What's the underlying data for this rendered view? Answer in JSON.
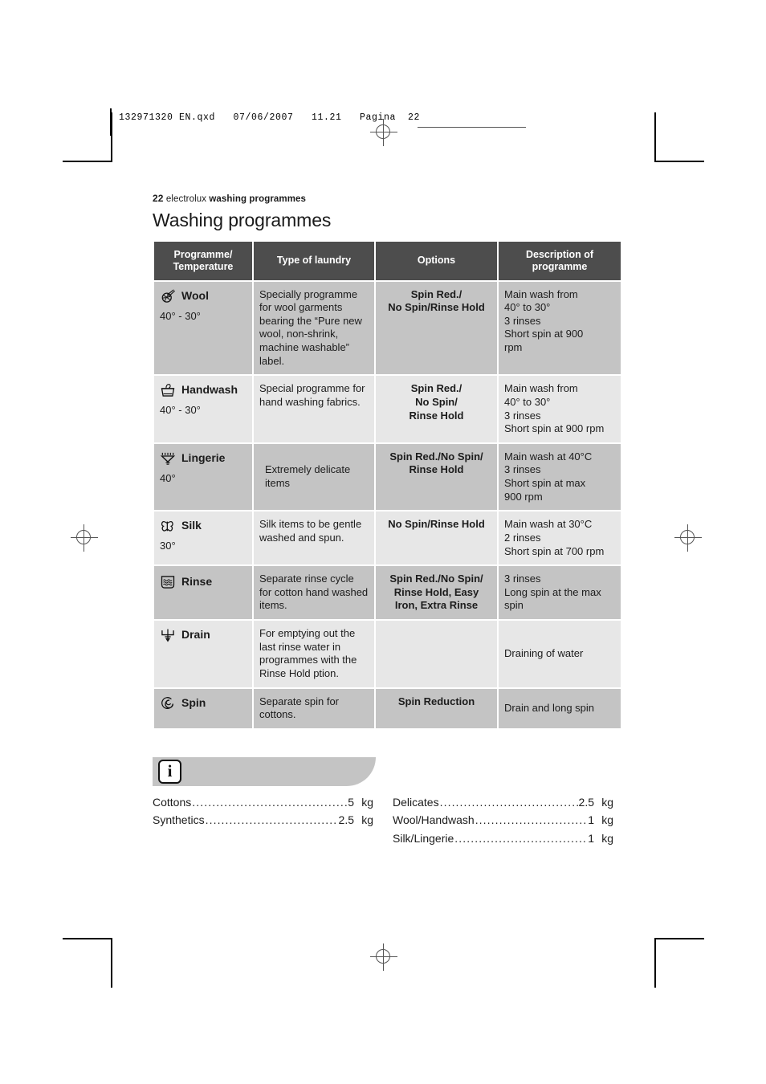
{
  "file_header": "132971320 EN.qxd   07/06/2007   11.21   Pagina  22",
  "breadcrumb": {
    "page_number": "22",
    "brand": "electrolux",
    "section": "washing programmes"
  },
  "title": "Washing programmes",
  "table": {
    "headers": [
      "Programme/\nTemperature",
      "Type of laundry",
      "Options",
      "Description of\nprogramme"
    ],
    "headers_flat": {
      "programme_temperature_line1": "Programme/",
      "programme_temperature_line2": "Temperature",
      "type_of_laundry": "Type of laundry",
      "options": "Options",
      "description_line1": "Description of",
      "description_line2": "programme"
    },
    "rows": [
      {
        "icon": "wool-icon",
        "programme": "Wool",
        "temperature": "40° - 30°",
        "type_of_laundry": "Specially programme for wool garments bearing the “Pure new wool, non-shrink, machine washable” label.",
        "options": "Spin Red./\nNo Spin/Rinse Hold",
        "description": "Main wash from\n40° to 30°\n3 rinses\nShort spin at 900\nrpm"
      },
      {
        "icon": "handwash-icon",
        "programme": "Handwash",
        "temperature": "40° - 30°",
        "type_of_laundry": "Special programme for hand washing fabrics.",
        "options": "Spin Red./\nNo Spin/\nRinse Hold",
        "description": "Main wash from\n40° to 30°\n3 rinses\nShort spin at 900 rpm"
      },
      {
        "icon": "lingerie-icon",
        "programme": "Lingerie",
        "temperature": "40°",
        "type_of_laundry": "Extremely delicate items",
        "options": "Spin Red./No Spin/\nRinse Hold",
        "description": "Main wash at 40°C\n3 rinses\nShort spin at max\n900 rpm"
      },
      {
        "icon": "silk-icon",
        "programme": "Silk",
        "temperature": "30°",
        "type_of_laundry": "Silk items to be gentle washed and spun.",
        "options": "No Spin/Rinse Hold",
        "description": "Main wash at 30°C\n2 rinses\nShort spin at 700 rpm"
      },
      {
        "icon": "rinse-icon",
        "programme": "Rinse",
        "temperature": "",
        "type_of_laundry": "Separate rinse cycle for cotton hand washed items.",
        "options": "Spin Red./No Spin/\nRinse Hold, Easy\nIron, Extra Rinse",
        "description": "3 rinses\nLong spin at the max\nspin"
      },
      {
        "icon": "drain-icon",
        "programme": "Drain",
        "temperature": "",
        "type_of_laundry": "For emptying out the last rinse water in programmes with the Rinse Hold ption.",
        "options": "",
        "description": "Draining of water"
      },
      {
        "icon": "spin-icon",
        "programme": "Spin",
        "temperature": "",
        "type_of_laundry": "Separate spin for cottons.",
        "options": "Spin Reduction",
        "description": "Drain and long spin"
      }
    ]
  },
  "info": {
    "badge": "i",
    "loads_left": [
      {
        "name": "Cottons",
        "value": "5",
        "unit": "kg"
      },
      {
        "name": "Synthetics",
        "value": "2.5",
        "unit": "kg"
      }
    ],
    "loads_right": [
      {
        "name": "Delicates",
        "value": "2.5",
        "unit": "kg"
      },
      {
        "name": "Wool/Handwash",
        "value": "1",
        "unit": "kg"
      },
      {
        "name": "Silk/Lingerie",
        "value": "1",
        "unit": "kg"
      }
    ]
  },
  "colors": {
    "header_bg": "#4d4d4d",
    "row_dark": "#c4c4c4",
    "row_light": "#e7e7e7",
    "text": "#1c1c1c"
  }
}
